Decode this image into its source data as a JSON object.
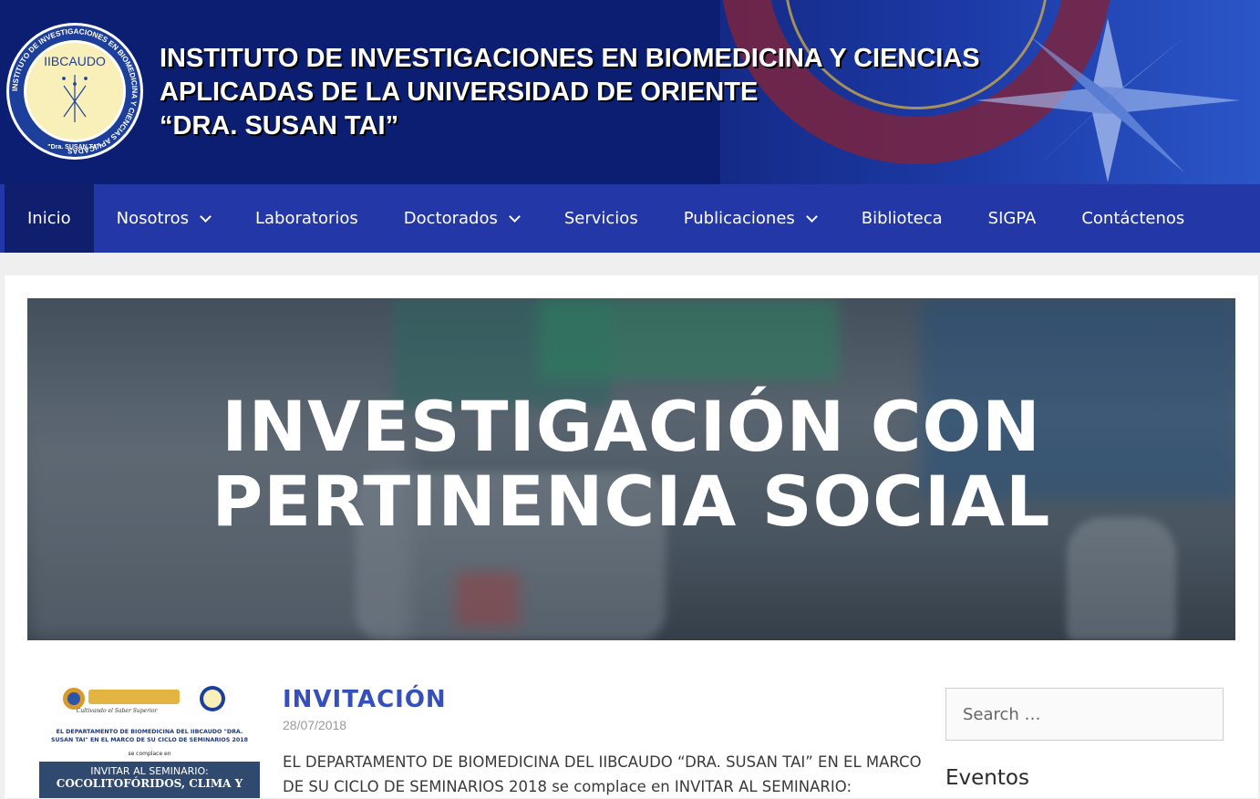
{
  "header": {
    "logo": {
      "abbr": "IIBCAUDO",
      "ring_text": "INSTITUTO DE INVESTIGACIONES EN BIOMEDICINA Y CIENCIAS APLICADAS",
      "bottom_text": "\"Dra. SUSAN TAI\""
    },
    "title_lines": [
      "INSTITUTO DE INVESTIGACIONES EN BIOMEDICINA Y CIENCIAS",
      "APLICADAS DE LA UNIVERSIDAD DE ORIENTE",
      "“DRA. SUSAN TAI”"
    ]
  },
  "nav": {
    "items": [
      {
        "label": "Inicio",
        "active": true,
        "has_dropdown": false
      },
      {
        "label": "Nosotros",
        "active": false,
        "has_dropdown": true
      },
      {
        "label": "Laboratorios",
        "active": false,
        "has_dropdown": false
      },
      {
        "label": "Doctorados",
        "active": false,
        "has_dropdown": true
      },
      {
        "label": "Servicios",
        "active": false,
        "has_dropdown": false
      },
      {
        "label": "Publicaciones",
        "active": false,
        "has_dropdown": true
      },
      {
        "label": "Biblioteca",
        "active": false,
        "has_dropdown": false
      },
      {
        "label": "SIGPA",
        "active": false,
        "has_dropdown": false
      },
      {
        "label": "Contáctenos",
        "active": false,
        "has_dropdown": false
      }
    ]
  },
  "hero": {
    "title_lines": [
      "INVESTIGACIÓN CON",
      "PERTINENCIA SOCIAL"
    ]
  },
  "post": {
    "thumbnail": {
      "slogan": "Cultivando el Saber Superior",
      "text": "EL DEPARTAMENTO DE BIOMEDICINA DEL IIBCAUDO \"DRA. SUSAN TAI\" EN EL MARCO DE SU CICLO DE SEMINARIOS 2018",
      "sub": "se complace en",
      "box_line1": "INVITAR AL SEMINARIO:",
      "box_line2": "COCOLITOFÓRIDOS, CLIMA Y"
    },
    "title": "INVITACIÓN",
    "date": "28/07/2018",
    "excerpt": "EL DEPARTAMENTO DE BIOMEDICINA DEL IIBCAUDO “DRA. SUSAN TAI” EN EL MARCO DE SU  CICLO DE SEMINARIOS 2018 se complace en INVITAR AL SEMINARIO:"
  },
  "sidebar": {
    "search_placeholder": "Search …",
    "widget_title": "Eventos"
  },
  "colors": {
    "header_bg": "#0b1e72",
    "nav_bg": "#2437a6",
    "nav_active": "#0f1f6e",
    "post_title": "#3550b8"
  }
}
